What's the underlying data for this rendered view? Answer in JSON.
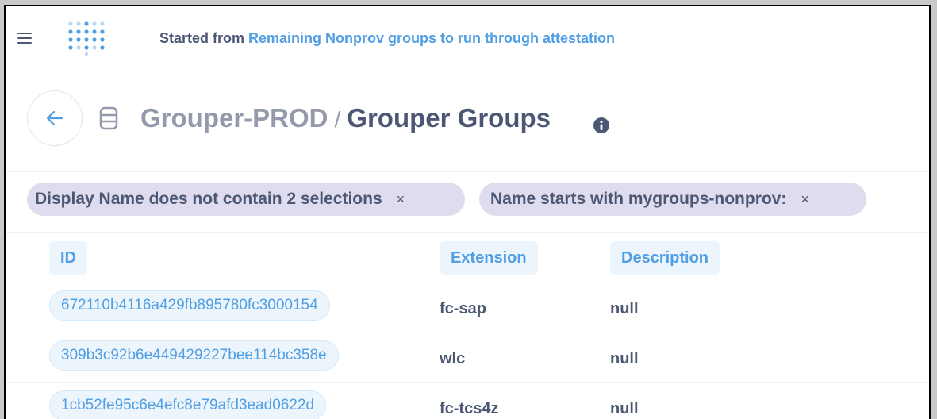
{
  "topbar": {
    "started_prefix": "Started from",
    "started_link": "Remaining Nonprov groups to run through attestation"
  },
  "header": {
    "database": "Grouper-PROD",
    "separator": "/",
    "table": "Grouper Groups"
  },
  "filters": [
    {
      "label": "Display Name does not contain 2 selections",
      "remove": "×"
    },
    {
      "label": "Name starts with mygroups-nonprov:",
      "remove": "×"
    }
  ],
  "columns": [
    "ID",
    "Extension",
    "Description"
  ],
  "rows": [
    {
      "id": "672110b4116a429fb895780fc3000154",
      "extension": "fc-sap",
      "description": "null"
    },
    {
      "id": "309b3c92b6e449429227bee114bc358e",
      "extension": "wlc",
      "description": "null"
    },
    {
      "id": "1cb52fe95c6e4efc8e79afd3ead0622d",
      "extension": "fc-tcs4z",
      "description": "null"
    }
  ],
  "colors": {
    "accent": "#509ee3",
    "text_dark": "#4c5773",
    "text_muted": "#949aab",
    "filter_pill": "#dfdcf0",
    "id_pill": "#edf5fc"
  },
  "icons": [
    "hamburger-icon",
    "app-logo",
    "back-arrow-icon",
    "database-icon",
    "info-icon",
    "close-icon"
  ]
}
